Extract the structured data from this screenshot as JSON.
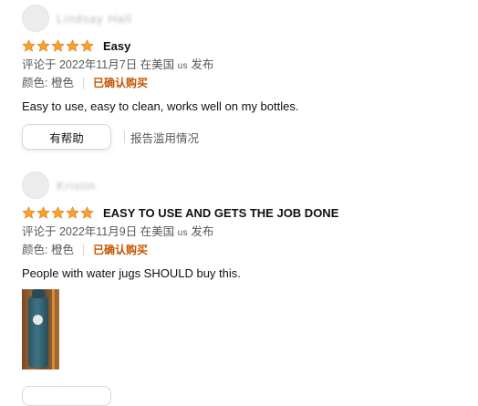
{
  "reviews": [
    {
      "reviewer_name": "Lindsay Hall",
      "rating": 5,
      "title": "Easy",
      "meta_prefix": "评论于 2022年11月7日 在美国",
      "country_code": "us",
      "meta_suffix": "发布",
      "color_label": "颜色: 橙色",
      "verified": "已确认购买",
      "body": "Easy to use, easy to clean, works well on my bottles.",
      "helpful_label": "有帮助",
      "report_label": "报告滥用情况"
    },
    {
      "reviewer_name": "Kristin",
      "rating": 5,
      "title": "EASY TO USE AND GETS THE JOB DONE",
      "meta_prefix": "评论于 2022年11月9日 在美国",
      "country_code": "us",
      "meta_suffix": "发布",
      "color_label": "颜色: 橙色",
      "verified": "已确认购买",
      "body": "People with water jugs SHOULD buy this."
    }
  ],
  "colors": {
    "star": "#f7a22a",
    "verified": "#c45500",
    "text": "#0f1111",
    "muted": "#565959"
  }
}
